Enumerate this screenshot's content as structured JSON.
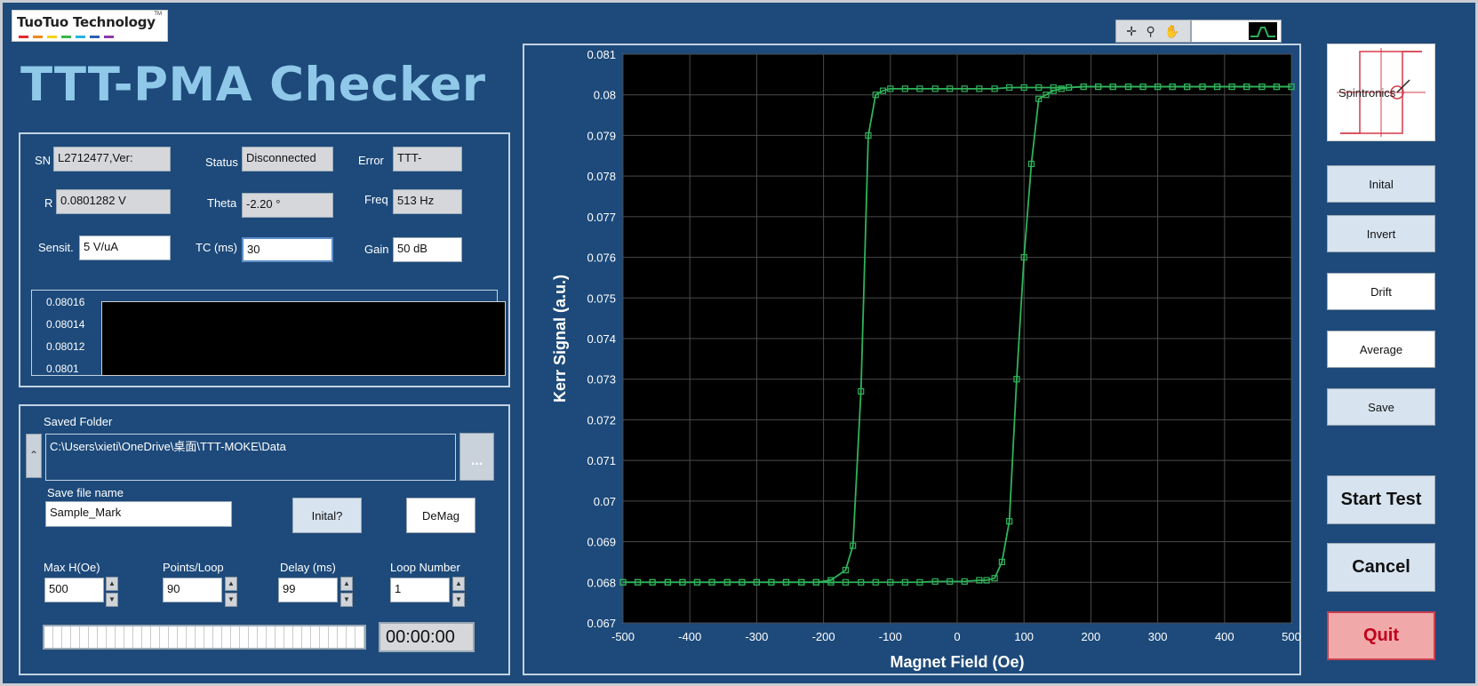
{
  "app": {
    "logo_text": "TuoTuo Technology",
    "logo_tm": "TM",
    "logo_colors": [
      "#e8262a",
      "#f28a1c",
      "#f4d21c",
      "#3ab54a",
      "#2ab0e0",
      "#2d5fb0",
      "#8a3aa8"
    ],
    "title": "TTT-PMA Checker"
  },
  "info": {
    "sn_label": "SN",
    "sn_value": "L2712477,Ver:",
    "status_label": "Status",
    "status_value": "Disconnected",
    "error_label": "Error",
    "error_value": "TTT-",
    "r_label": "R",
    "r_value": "0.0801282 V",
    "theta_label": "Theta",
    "theta_value": "-2.20 °",
    "freq_label": "Freq",
    "freq_value": "513 Hz",
    "sensit_label": "Sensit.",
    "sensit_value": "5 V/uA",
    "tc_label": "TC (ms)",
    "tc_value": "30",
    "gain_label": "Gain",
    "gain_value": "50 dB"
  },
  "mini_chart": {
    "ticks": [
      "0.08016",
      "0.08014",
      "0.08012",
      "0.0801"
    ]
  },
  "file": {
    "saved_folder_label": "Saved Folder",
    "folder_path": "C:\\Users\\xieti\\OneDrive\\桌面\\TTT-MOKE\\Data",
    "browse_label": "...",
    "save_name_label": "Save file name",
    "save_name_value": "Sample_Mark",
    "inital_q_label": "Inital?",
    "demag_label": "DeMag",
    "maxh_label": "Max H(Oe)",
    "maxh_value": "500",
    "points_label": "Points/Loop",
    "points_value": "90",
    "delay_label": "Delay (ms)",
    "delay_value": "99",
    "loop_label": "Loop Number",
    "loop_value": "1",
    "timer": "00:00:00"
  },
  "buttons": {
    "inital": "Inital",
    "invert": "Invert",
    "drift": "Drift",
    "average": "Average",
    "save": "Save",
    "start": "Start Test",
    "cancel": "Cancel",
    "quit": "Quit"
  },
  "spin_logo_text": "Spintronics",
  "chart_data": {
    "type": "line",
    "title": "",
    "xlabel": "Magnet Field (Oe)",
    "ylabel": "Kerr Signal (a.u.)",
    "xlim": [
      -500,
      500
    ],
    "ylim": [
      0.067,
      0.081
    ],
    "xticks": [
      -500,
      -400,
      -300,
      -200,
      -100,
      0,
      100,
      200,
      300,
      400,
      500
    ],
    "yticks": [
      0.067,
      0.068,
      0.069,
      0.07,
      0.071,
      0.072,
      0.073,
      0.074,
      0.075,
      0.076,
      0.077,
      0.078,
      0.079,
      0.08,
      0.081
    ],
    "ytick_labels": [
      "0.067",
      "0.068",
      "0.069",
      "0.07",
      "0.071",
      "0.072",
      "0.073",
      "0.074",
      "0.075",
      "0.076",
      "0.077",
      "0.078",
      "0.079",
      "0.08",
      "0.081"
    ],
    "grid": true,
    "line_color": "#2fb35a",
    "background": "#000000",
    "series": [
      {
        "x": [
          -500,
          -478,
          -456,
          -433,
          -411,
          -389,
          -367,
          -344,
          -322,
          -300,
          -278,
          -256,
          -233,
          -211,
          -189,
          -167,
          -156,
          -144,
          -133,
          -122,
          -111,
          -100,
          -78,
          -56,
          -33,
          -11,
          11,
          33,
          56,
          78,
          100,
          122,
          144,
          167,
          189,
          211,
          233,
          256,
          278,
          300,
          322,
          344,
          367,
          389,
          411,
          433,
          456,
          478,
          500
        ],
        "y": [
          0.068,
          0.068,
          0.068,
          0.068,
          0.068,
          0.068,
          0.068,
          0.068,
          0.068,
          0.068,
          0.068,
          0.068,
          0.068,
          0.068,
          0.06805,
          0.0683,
          0.0689,
          0.0727,
          0.079,
          0.08,
          0.0801,
          0.08015,
          0.08015,
          0.08015,
          0.08015,
          0.08015,
          0.08015,
          0.08015,
          0.08015,
          0.08018,
          0.08018,
          0.08018,
          0.08018,
          0.08018,
          0.0802,
          0.0802,
          0.0802,
          0.0802,
          0.0802,
          0.0802,
          0.0802,
          0.0802,
          0.0802,
          0.0802,
          0.0802,
          0.0802,
          0.0802,
          0.0802,
          0.0802
        ]
      },
      {
        "x": [
          500,
          478,
          456,
          433,
          411,
          389,
          367,
          344,
          322,
          300,
          278,
          256,
          233,
          211,
          189,
          167,
          156,
          144,
          133,
          122,
          111,
          100,
          89,
          78,
          67,
          56,
          44,
          33,
          11,
          -11,
          -33,
          -56,
          -78,
          -100,
          -122,
          -144,
          -167,
          -189,
          -211,
          -233,
          -256,
          -278,
          -300,
          -322,
          -344,
          -367,
          -389,
          -411,
          -433,
          -456,
          -478,
          -500
        ],
        "y": [
          0.0802,
          0.0802,
          0.0802,
          0.0802,
          0.0802,
          0.0802,
          0.0802,
          0.0802,
          0.0802,
          0.0802,
          0.0802,
          0.0802,
          0.0802,
          0.0802,
          0.0802,
          0.08018,
          0.08015,
          0.0801,
          0.08,
          0.0799,
          0.0783,
          0.076,
          0.073,
          0.0695,
          0.0685,
          0.0681,
          0.06805,
          0.06805,
          0.06802,
          0.06802,
          0.06802,
          0.068,
          0.068,
          0.068,
          0.068,
          0.068,
          0.068,
          0.068,
          0.068,
          0.068,
          0.068,
          0.068,
          0.068,
          0.068,
          0.068,
          0.068,
          0.068,
          0.068,
          0.068,
          0.068,
          0.068,
          0.068
        ]
      }
    ]
  }
}
